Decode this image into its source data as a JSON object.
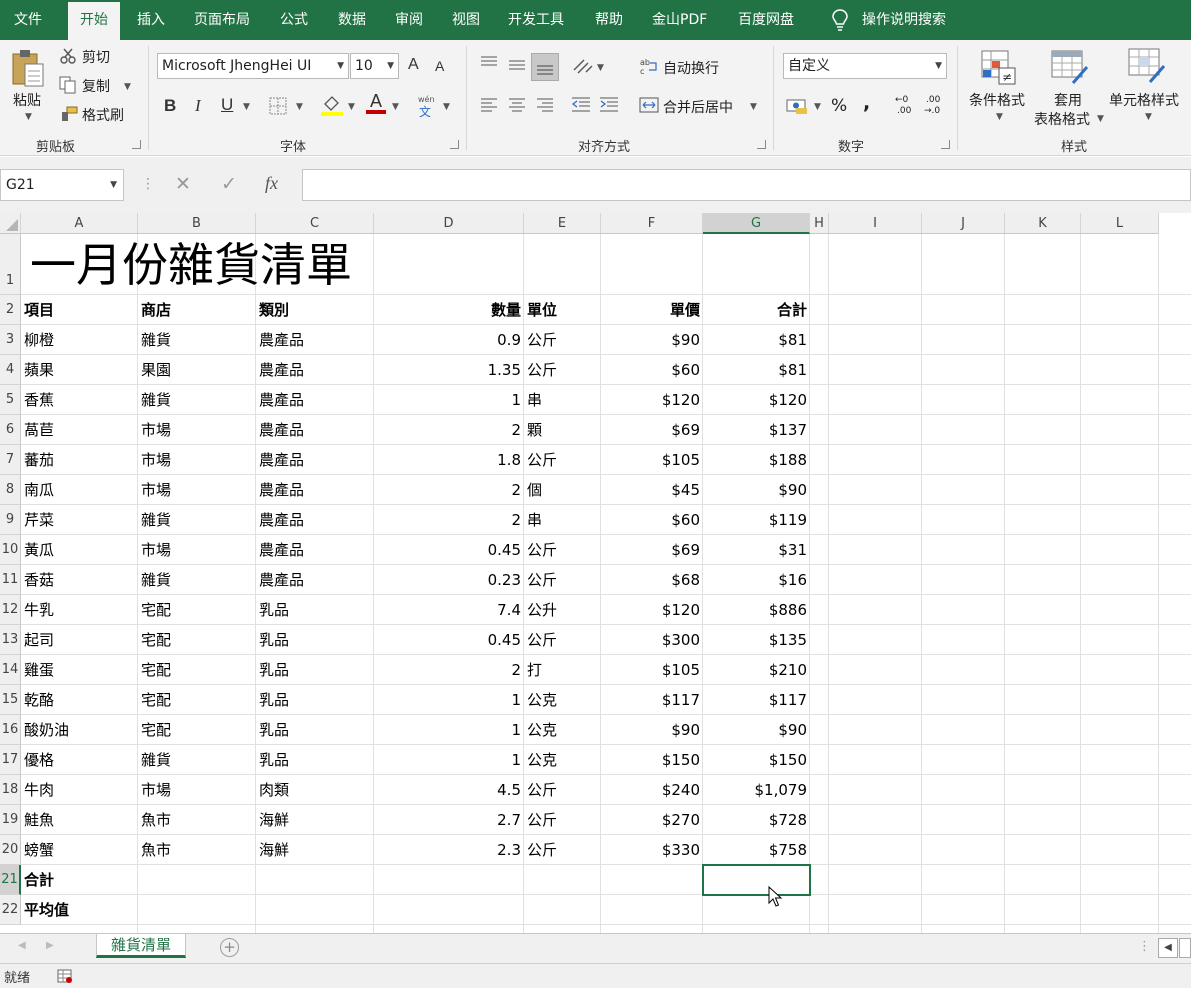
{
  "menu": {
    "items": [
      "文件",
      "开始",
      "插入",
      "页面布局",
      "公式",
      "数据",
      "审阅",
      "视图",
      "开发工具",
      "帮助",
      "金山PDF",
      "百度网盘"
    ],
    "active": "开始",
    "search_label": "操作说明搜索"
  },
  "ribbon": {
    "clipboard": {
      "paste": "粘贴",
      "cut": "剪切",
      "copy": "复制",
      "format_painter": "格式刷",
      "label": "剪贴板"
    },
    "font": {
      "name": "Microsoft JhengHei UI",
      "size": "10",
      "label": "字体",
      "bold": "B",
      "italic": "I",
      "underline": "U",
      "grow": "A",
      "shrink": "A",
      "font_color": "A",
      "phonetic_top": "wén",
      "phonetic_bottom": "文"
    },
    "alignment": {
      "wrap": "自动换行",
      "merge": "合并后居中",
      "label": "对齐方式"
    },
    "number": {
      "format": "自定义",
      "percent": "%",
      "comma": ",",
      "inc_top": "←0",
      "inc_bottom": ".00",
      "dec_top": ".00",
      "dec_bottom": "→.0",
      "label": "数字"
    },
    "styles": {
      "conditional": "条件格式",
      "table_top": "套用",
      "table_bottom": "表格格式",
      "cell_styles": "单元格样式",
      "label": "样式"
    }
  },
  "formula_bar": {
    "name_box": "G21",
    "cancel": "✕",
    "enter": "✓",
    "fx": "fx",
    "content": ""
  },
  "columns": [
    "A",
    "B",
    "C",
    "D",
    "E",
    "F",
    "G",
    "H",
    "I",
    "J",
    "K",
    "L"
  ],
  "selected_column": "G",
  "selected_row": "21",
  "rows": [
    "1",
    "2",
    "3",
    "4",
    "5",
    "6",
    "7",
    "8",
    "9",
    "10",
    "11",
    "12",
    "13",
    "14",
    "15",
    "16",
    "17",
    "18",
    "19",
    "20",
    "21",
    "22"
  ],
  "sheet": {
    "title": "一月份雜貨清單",
    "headers": [
      "項目",
      "商店",
      "類別",
      "數量",
      "單位",
      "單價",
      "合計"
    ],
    "data": [
      [
        "柳橙",
        "雜貨",
        "農產品",
        "0.9",
        "公斤",
        "$90",
        "$81"
      ],
      [
        "蘋果",
        "果園",
        "農產品",
        "1.35",
        "公斤",
        "$60",
        "$81"
      ],
      [
        "香蕉",
        "雜貨",
        "農產品",
        "1",
        "串",
        "$120",
        "$120"
      ],
      [
        "萵苣",
        "市場",
        "農產品",
        "2",
        "顆",
        "$69",
        "$137"
      ],
      [
        "蕃茄",
        "市場",
        "農產品",
        "1.8",
        "公斤",
        "$105",
        "$188"
      ],
      [
        "南瓜",
        "市場",
        "農產品",
        "2",
        "個",
        "$45",
        "$90"
      ],
      [
        "芹菜",
        "雜貨",
        "農產品",
        "2",
        "串",
        "$60",
        "$119"
      ],
      [
        "黃瓜",
        "市場",
        "農產品",
        "0.45",
        "公斤",
        "$69",
        "$31"
      ],
      [
        "香菇",
        "雜貨",
        "農產品",
        "0.23",
        "公斤",
        "$68",
        "$16"
      ],
      [
        "牛乳",
        "宅配",
        "乳品",
        "7.4",
        "公升",
        "$120",
        "$886"
      ],
      [
        "起司",
        "宅配",
        "乳品",
        "0.45",
        "公斤",
        "$300",
        "$135"
      ],
      [
        "雞蛋",
        "宅配",
        "乳品",
        "2",
        "打",
        "$105",
        "$210"
      ],
      [
        "乾酪",
        "宅配",
        "乳品",
        "1",
        "公克",
        "$117",
        "$117"
      ],
      [
        "酸奶油",
        "宅配",
        "乳品",
        "1",
        "公克",
        "$90",
        "$90"
      ],
      [
        "優格",
        "雜貨",
        "乳品",
        "1",
        "公克",
        "$150",
        "$150"
      ],
      [
        "牛肉",
        "市場",
        "肉類",
        "4.5",
        "公斤",
        "$240",
        "$1,079"
      ],
      [
        "鮭魚",
        "魚市",
        "海鮮",
        "2.7",
        "公斤",
        "$270",
        "$728"
      ],
      [
        "螃蟹",
        "魚市",
        "海鮮",
        "2.3",
        "公斤",
        "$330",
        "$758"
      ]
    ],
    "total_label": "合計",
    "average_label": "平均值"
  },
  "tabs": {
    "active_sheet": "雜貨清單",
    "add": "+"
  },
  "status": {
    "text": "就绪"
  },
  "colors": {
    "accent": "#217346",
    "grid": "#e1e1e1",
    "header_bg": "#efefef"
  }
}
